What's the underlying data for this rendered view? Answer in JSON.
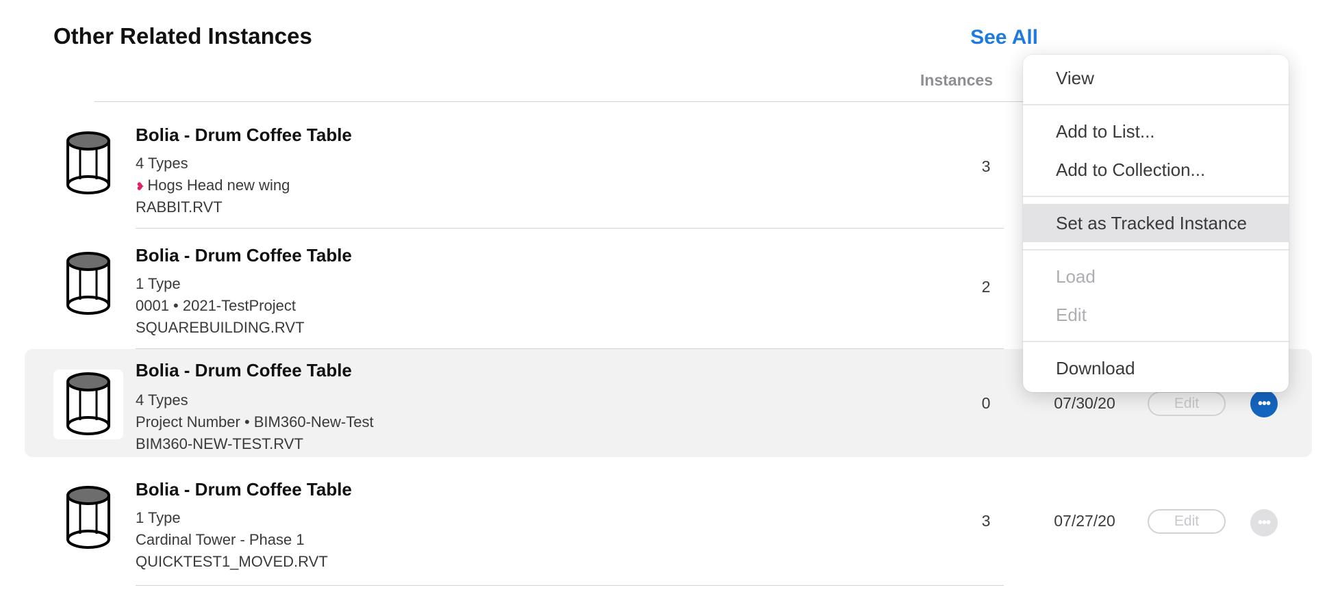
{
  "section": {
    "title": "Other Related Instances",
    "see_all": "See All"
  },
  "columns": {
    "instances": "Instances"
  },
  "rows": [
    {
      "title": "Bolia - Drum Coffee Table",
      "types": "4 Types",
      "project": "Hogs Head new wing",
      "project_icon": "heart-icon",
      "file": "RABBIT.RVT",
      "instances": "3",
      "date": "",
      "edit_label": "",
      "selected": false
    },
    {
      "title": "Bolia - Drum Coffee Table",
      "types": "1 Type",
      "project": "0001 • 2021-TestProject",
      "file": "SQUAREBUILDING.RVT",
      "instances": "2",
      "date": "",
      "edit_label": "",
      "selected": false
    },
    {
      "title": "Bolia - Drum Coffee Table",
      "types": "4 Types",
      "project": "Project Number • BIM360-New-Test",
      "file": "BIM360-NEW-TEST.RVT",
      "instances": "0",
      "date": "07/30/20",
      "edit_label": "Edit",
      "selected": true
    },
    {
      "title": "Bolia - Drum Coffee Table",
      "types": "1 Type",
      "project": "Cardinal Tower - Phase 1",
      "file": "QUICKTEST1_MOVED.RVT",
      "instances": "3",
      "date": "07/27/20",
      "edit_label": "Edit",
      "selected": false
    }
  ],
  "context_menu": {
    "items": [
      {
        "label": "View",
        "enabled": true
      },
      {
        "label": "Add to List...",
        "enabled": true
      },
      {
        "label": "Add to Collection...",
        "enabled": true
      },
      {
        "label": "Set as Tracked Instance",
        "enabled": true,
        "highlighted": true
      },
      {
        "label": "Load",
        "enabled": false
      },
      {
        "label": "Edit",
        "enabled": false
      },
      {
        "label": "Download",
        "enabled": true
      }
    ]
  },
  "more_glyph": "•••",
  "colors": {
    "accent": "#1f7ae0",
    "more_active": "#1565c0",
    "heart": "#e0245e"
  }
}
